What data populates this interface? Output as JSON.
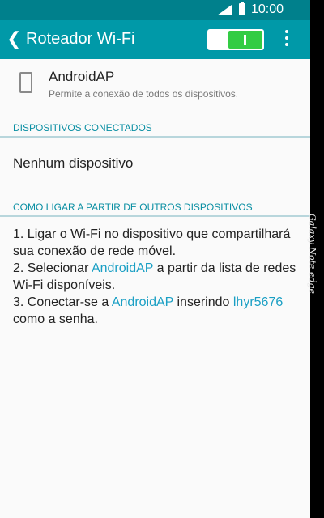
{
  "status_bar": {
    "time": "10:00"
  },
  "header": {
    "title": "Roteador Wi-Fi",
    "toggle_on": true
  },
  "network": {
    "name": "AndroidAP",
    "description": "Permite a conexão de todos os dispositivos."
  },
  "sections": {
    "connected_header": "DISPOSITIVOS CONECTADOS",
    "connected_empty": "Nenhum dispositivo",
    "howto_header": "COMO LIGAR A PARTIR DE OUTROS DISPOSITIVOS"
  },
  "instructions": {
    "step1": "1. Ligar o Wi-Fi no dispositivo que compartilhará sua conexão de rede móvel.",
    "step2_before": "2. Selecionar ",
    "step2_network": "AndroidAP",
    "step2_after": " a partir da lista de redes Wi-Fi disponíveis.",
    "step3_before": "3. Conectar-se a ",
    "step3_network": "AndroidAP",
    "step3_mid": " inserindo ",
    "step3_password": "lhyr5676",
    "step3_after": " como a senha."
  },
  "device_edge_label": "Galaxy Note edge",
  "colors": {
    "status_bar": "#00808c",
    "app_bar": "#0099a8",
    "accent": "#1a9fc4",
    "toggle_on": "#33cc44"
  }
}
